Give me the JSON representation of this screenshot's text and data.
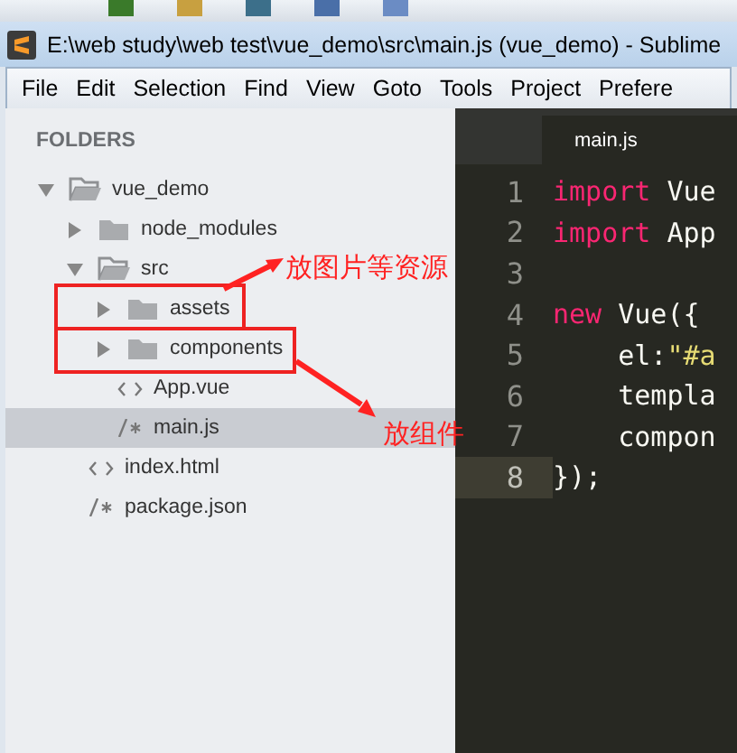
{
  "window": {
    "title": "E:\\web study\\web test\\vue_demo\\src\\main.js (vue_demo) - Sublime"
  },
  "menu": [
    "File",
    "Edit",
    "Selection",
    "Find",
    "View",
    "Goto",
    "Tools",
    "Project",
    "Prefere"
  ],
  "sidebar": {
    "heading": "FOLDERS",
    "tree": [
      {
        "kind": "folder",
        "name": "vue_demo",
        "expanded": true,
        "selected": false,
        "children": [
          {
            "kind": "folder",
            "name": "node_modules",
            "expanded": false,
            "selected": false
          },
          {
            "kind": "folder",
            "name": "src",
            "expanded": true,
            "selected": false,
            "children": [
              {
                "kind": "folder",
                "name": "assets",
                "expanded": false,
                "selected": false,
                "annotation": "放图片等资源"
              },
              {
                "kind": "folder",
                "name": "components",
                "expanded": false,
                "selected": false,
                "annotation": "放组件"
              },
              {
                "kind": "markup",
                "name": "App.vue",
                "selected": false
              },
              {
                "kind": "script",
                "name": "main.js",
                "selected": true
              }
            ]
          },
          {
            "kind": "markup",
            "name": "index.html",
            "selected": false
          },
          {
            "kind": "script",
            "name": "package.json",
            "selected": false
          }
        ]
      }
    ]
  },
  "editor": {
    "tab": "main.js",
    "lines": [
      {
        "number": "1",
        "tokens": [
          {
            "kind": "keyword",
            "text": "import"
          },
          {
            "kind": "plain",
            "text": " Vue"
          }
        ]
      },
      {
        "number": "2",
        "tokens": [
          {
            "kind": "keyword",
            "text": "import"
          },
          {
            "kind": "plain",
            "text": " App"
          }
        ]
      },
      {
        "number": "3"
      },
      {
        "number": "4",
        "tokens": [
          {
            "kind": "keyword",
            "text": "new"
          },
          {
            "kind": "plain",
            "text": " Vue({"
          }
        ]
      },
      {
        "number": "5",
        "tokens": [
          {
            "kind": "plain",
            "text": "    el:"
          },
          {
            "kind": "string",
            "text": "\"#a"
          }
        ]
      },
      {
        "number": "6",
        "tokens": [
          {
            "kind": "plain",
            "text": "    templa"
          }
        ]
      },
      {
        "number": "7",
        "tokens": [
          {
            "kind": "plain",
            "text": "    compon"
          }
        ]
      },
      {
        "number": "8",
        "current": true,
        "tokens": [
          {
            "kind": "plain",
            "text": "});"
          }
        ]
      }
    ]
  }
}
